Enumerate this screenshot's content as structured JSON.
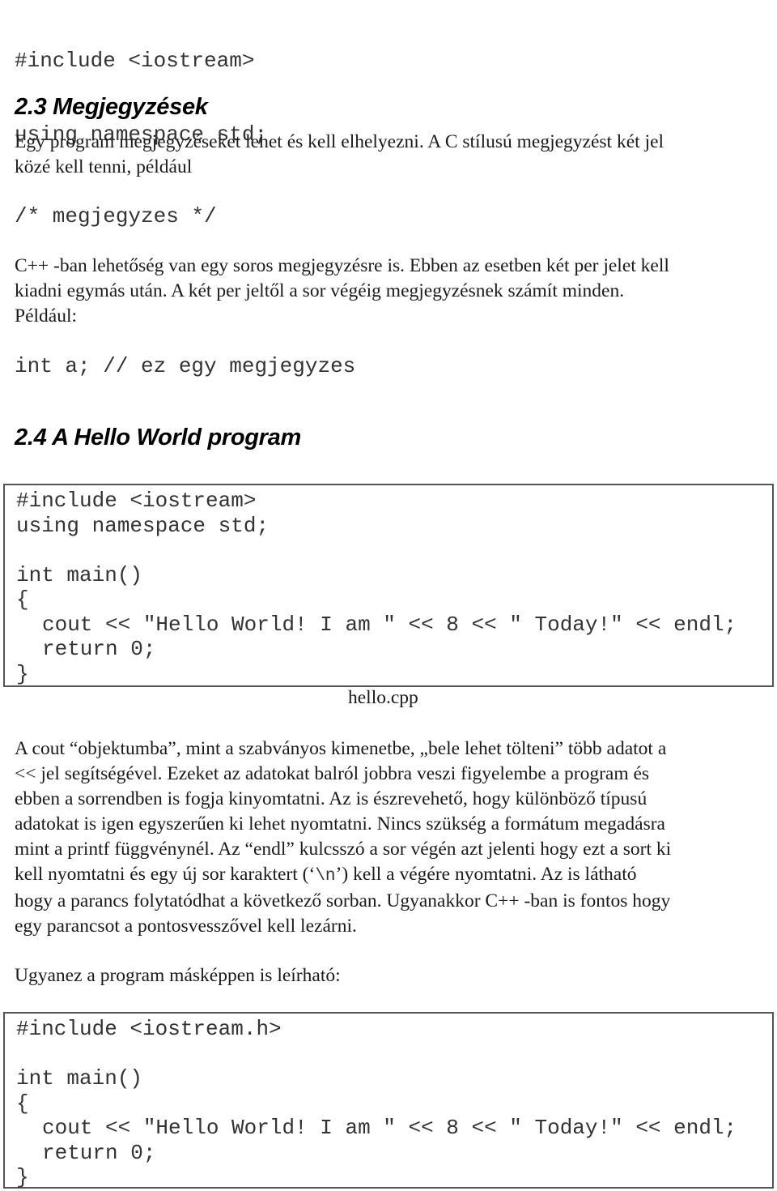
{
  "intro_code": {
    "lines": [
      "#include <iostream>",
      "using namespace std;"
    ]
  },
  "section_2_3": {
    "heading": "2.3 Megjegyzések",
    "para1_lines": [
      "Egy program megjegyzéseket lehet és kell elhelyezni. A C stílusú megjegyzést két jel",
      "közé kell tenni, például"
    ],
    "c_comment_example": "/* megjegyzes */",
    "para2_lines": [
      "C++ -ban lehetőség van egy soros megjegyzésre is. Ebben az esetben két per jelet kell",
      "kiadni egymás után. A két per jeltől a sor végéig megjegyzésnek számít minden.",
      "Például:"
    ],
    "cpp_comment_example": "int a; // ez egy megjegyzes"
  },
  "section_2_4": {
    "heading": "2.4 A Hello World program",
    "code_box_1": {
      "lines": [
        {
          "text": "#include <iostream>",
          "indent": false
        },
        {
          "text": "using namespace std;",
          "indent": false
        },
        {
          "text": "",
          "indent": false
        },
        {
          "text": "int main()",
          "indent": false
        },
        {
          "text": "{",
          "indent": false
        },
        {
          "text": "cout << \"Hello World! I am \" << 8 << \" Today!\" << endl;",
          "indent": true
        },
        {
          "text": "return 0;",
          "indent": true
        },
        {
          "text": "}",
          "indent": false
        }
      ],
      "caption": "hello.cpp"
    },
    "explanation_lines": [
      "A cout “objektumba”, mint a szabványos kimenetbe, „bele lehet tölteni” több adatot a",
      "<< jel segítségével. Ezeket az adatokat balról jobbra veszi figyelembe a program és",
      "ebben a sorrendben is fogja kinyomtatni. Az is észrevehető, hogy különböző típusú",
      "adatokat is igen egyszerűen ki lehet nyomtatni. Nincs szükség a formátum megadásra",
      "mint a printf függvénynél. Az “endl” kulcsszó a sor végén azt jelenti hogy ezt a sort ki"
    ],
    "newline_line": {
      "before": "kell nyomtatni és egy új sor karaktert (‘",
      "code": "\\n",
      "after": "’) kell a végére nyomtatni. Az is látható"
    },
    "explanation_tail_lines": [
      "hogy a parancs folytatódhat a következő sorban. Ugyanakkor C++ -ban is fontos hogy",
      "egy parancsot a pontosvesszővel kell lezárni."
    ],
    "alt_intro": "Ugyanez a program másképpen is leírható:",
    "code_box_2": {
      "lines": [
        {
          "text": "#include <iostream.h>",
          "indent": false
        },
        {
          "text": "",
          "indent": false
        },
        {
          "text": "int main()",
          "indent": false
        },
        {
          "text": "{",
          "indent": false
        },
        {
          "text": "cout << \"Hello World! I am \" << 8 << \" Today!\" << endl;",
          "indent": true
        },
        {
          "text": "return 0;",
          "indent": true
        },
        {
          "text": "}",
          "indent": false
        }
      ]
    }
  }
}
